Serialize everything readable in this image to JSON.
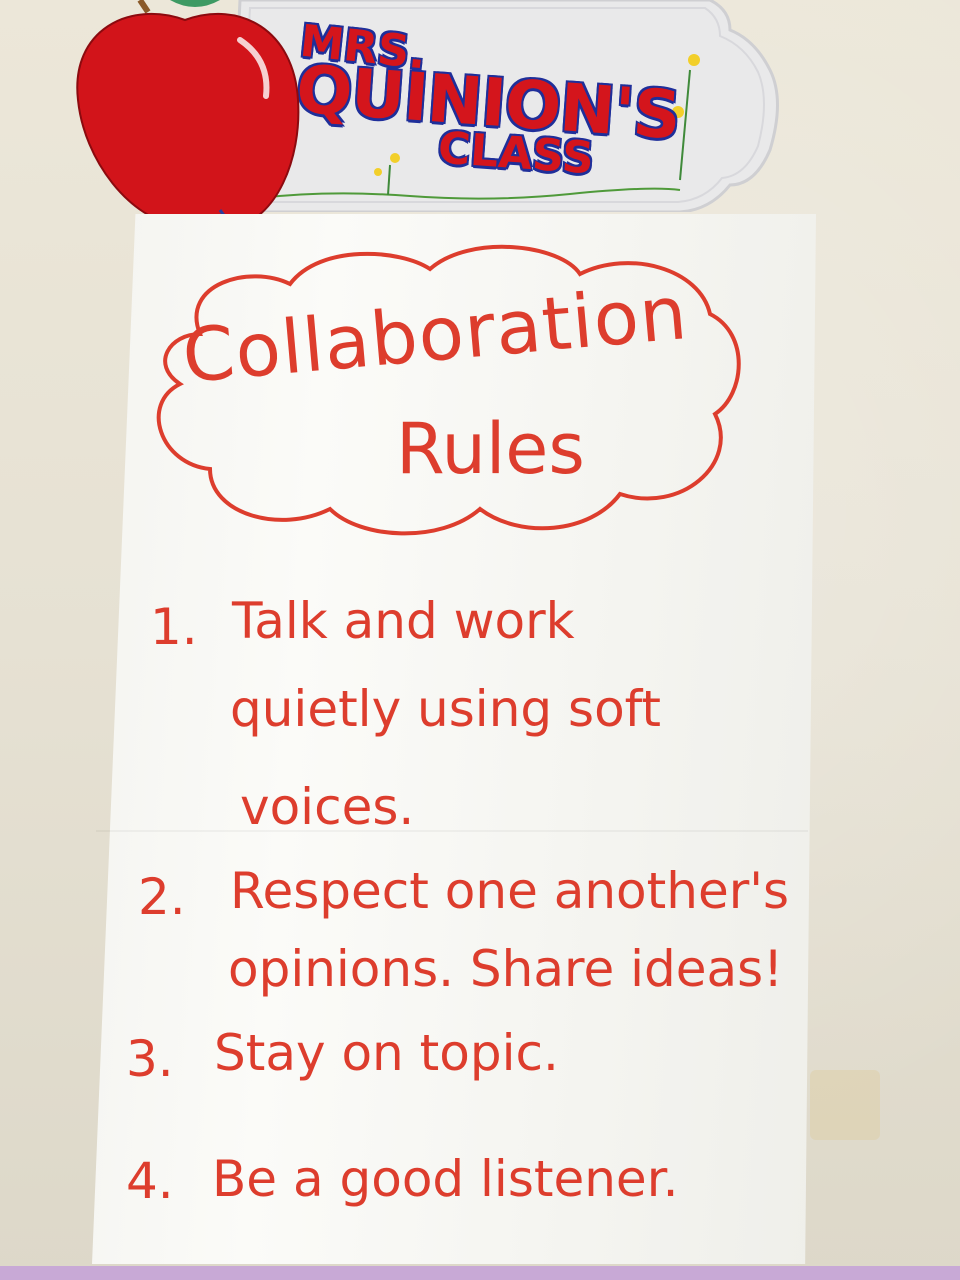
{
  "sign": {
    "line1": "MRS.",
    "line2": "QUINION'S",
    "line3": "CLASS"
  },
  "poster": {
    "title_line1": "Collaboration",
    "title_line2": "Rules",
    "rules": [
      {
        "number": "1.",
        "lines": [
          "Talk and work",
          "quietly using soft",
          "voices."
        ]
      },
      {
        "number": "2.",
        "lines": [
          "Respect one another's",
          "opinions. Share ideas!"
        ]
      },
      {
        "number": "3.",
        "lines": [
          "Stay on topic."
        ]
      },
      {
        "number": "4.",
        "lines": [
          "Be a good listener."
        ]
      }
    ]
  },
  "colors": {
    "marker": "#dd3d2d",
    "sign_letters": "#d4151c",
    "sign_outline": "#1f2f9a",
    "apple": "#d2141a"
  }
}
